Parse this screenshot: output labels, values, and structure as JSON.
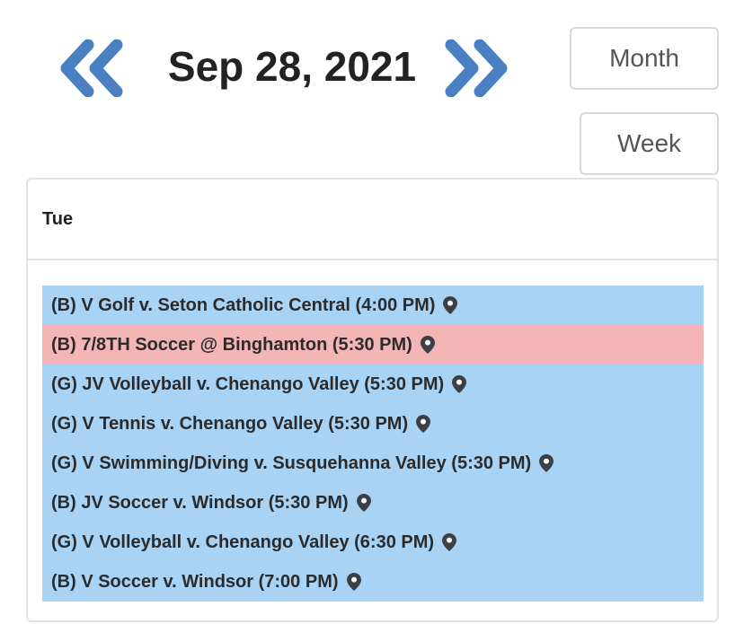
{
  "header": {
    "date": "Sep 28, 2021",
    "prev_icon": "double-chevron-left-icon",
    "next_icon": "double-chevron-right-icon",
    "accent_color": "#4a7fc1"
  },
  "view_buttons": {
    "month_label": "Month",
    "week_label": "Week"
  },
  "day": {
    "label": "Tue"
  },
  "events": [
    {
      "title": "(B) V Golf v. Seton Catholic Central (4:00 PM)",
      "color": "#a9d3f5",
      "icon": "map-pin-icon"
    },
    {
      "title": "(B) 7/8TH Soccer @ Binghamton (5:30 PM)",
      "color": "#f3b5b5",
      "icon": "map-pin-icon"
    },
    {
      "title": "(G) JV Volleyball v. Chenango Valley (5:30 PM)",
      "color": "#a9d3f5",
      "icon": "map-pin-icon"
    },
    {
      "title": "(G) V Tennis v. Chenango Valley (5:30 PM)",
      "color": "#a9d3f5",
      "icon": "map-pin-icon"
    },
    {
      "title": "(G) V Swimming/Diving v. Susquehanna Valley (5:30 PM)",
      "color": "#a9d3f5",
      "icon": "map-pin-icon"
    },
    {
      "title": "(B) JV Soccer v. Windsor (5:30 PM)",
      "color": "#a9d3f5",
      "icon": "map-pin-icon"
    },
    {
      "title": "(G) V Volleyball v. Chenango Valley (6:30 PM)",
      "color": "#a9d3f5",
      "icon": "map-pin-icon"
    },
    {
      "title": "(B) V Soccer v. Windsor (7:00 PM)",
      "color": "#a9d3f5",
      "icon": "map-pin-icon"
    }
  ]
}
